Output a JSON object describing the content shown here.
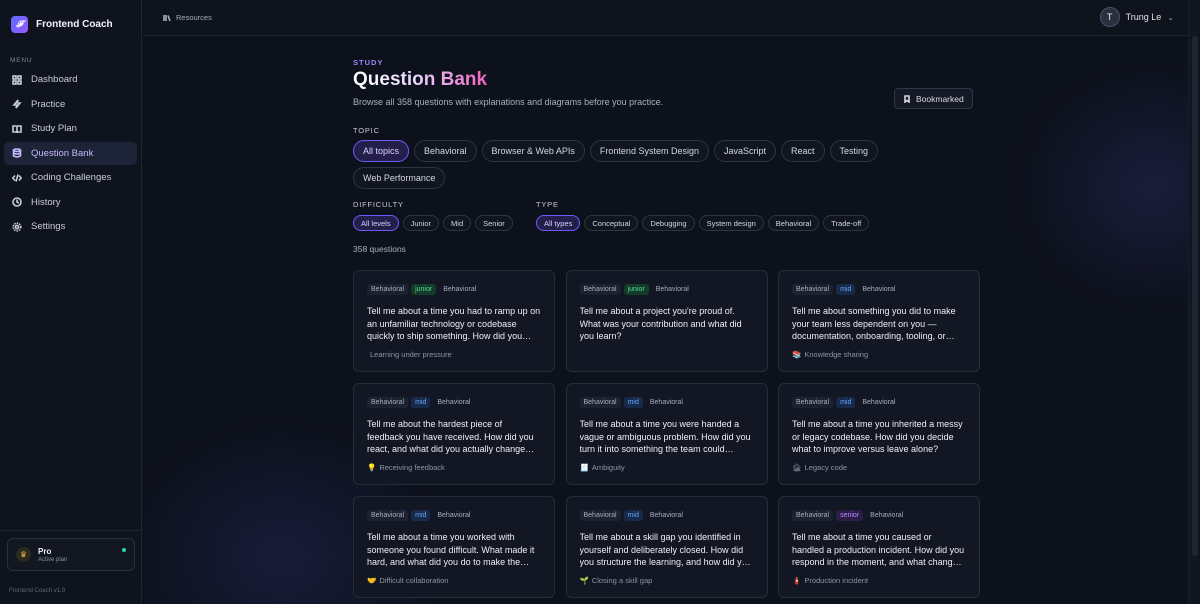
{
  "app": {
    "name": "Frontend Coach",
    "logo_glyph": "𝓕",
    "version": "Frontend Coach v1.0"
  },
  "sidebar": {
    "menu_label": "MENU",
    "items": [
      {
        "label": "Dashboard",
        "icon": "grid-icon"
      },
      {
        "label": "Practice",
        "icon": "bolt-icon"
      },
      {
        "label": "Study Plan",
        "icon": "book-icon"
      },
      {
        "label": "Question Bank",
        "icon": "database-icon",
        "active": true
      },
      {
        "label": "Coding Challenges",
        "icon": "code-icon"
      },
      {
        "label": "History",
        "icon": "clock-icon"
      },
      {
        "label": "Settings",
        "icon": "gear-icon"
      }
    ],
    "plan": {
      "title": "Pro",
      "subtitle": "Active plan",
      "icon": "crown-icon"
    }
  },
  "topbar": {
    "breadcrumb": "Resources",
    "user": {
      "initial": "T",
      "name": "Trung Le"
    }
  },
  "page": {
    "eyebrow": "STUDY",
    "title": "Question Bank",
    "subtitle": "Browse all 358 questions with explanations and diagrams before you practice.",
    "bookmarked_label": "Bookmarked",
    "topic_label": "TOPIC",
    "topics": [
      "All topics",
      "Behavioral",
      "Browser & Web APIs",
      "Frontend System Design",
      "JavaScript",
      "React",
      "Testing",
      "Web Performance"
    ],
    "difficulty_label": "DIFFICULTY",
    "difficulties": [
      "All levels",
      "Junior",
      "Mid",
      "Senior"
    ],
    "type_label": "TYPE",
    "types": [
      "All types",
      "Conceptual",
      "Debugging",
      "System design",
      "Behavioral",
      "Trade-off"
    ],
    "count": "358 questions"
  },
  "colors": {
    "accent": "#6b5bff",
    "junior": "#4ddc8f",
    "mid": "#6aa4ff",
    "senior": "#b98cff"
  },
  "cards": [
    {
      "topic": "Behavioral",
      "level": "junior",
      "type": "Behavioral",
      "question": "Tell me about a time you had to ramp up on an unfamiliar technology or codebase quickly to ship something. How did you approach it?",
      "tag_emoji": "",
      "tag": "Learning under pressure"
    },
    {
      "topic": "Behavioral",
      "level": "junior",
      "type": "Behavioral",
      "question": "Tell me about a project you're proud of. What was your contribution and what did you learn?",
      "tag_emoji": "",
      "tag": ""
    },
    {
      "topic": "Behavioral",
      "level": "mid",
      "type": "Behavioral",
      "question": "Tell me about something you did to make your team less dependent on you — documentation, onboarding, tooling, or mentoring.",
      "tag_emoji": "📚",
      "tag": "Knowledge sharing"
    },
    {
      "topic": "Behavioral",
      "level": "mid",
      "type": "Behavioral",
      "question": "Tell me about the hardest piece of feedback you have received. How did you react, and what did you actually change afterwards?",
      "tag_emoji": "💡",
      "tag": "Receiving feedback"
    },
    {
      "topic": "Behavioral",
      "level": "mid",
      "type": "Behavioral",
      "question": "Tell me about a time you were handed a vague or ambiguous problem. How did you turn it into something the team could execute on?",
      "tag_emoji": "🧾",
      "tag": "Ambiguity"
    },
    {
      "topic": "Behavioral",
      "level": "mid",
      "type": "Behavioral",
      "question": "Tell me about a time you inherited a messy or legacy codebase. How did you decide what to improve versus leave alone?",
      "tag_emoji": "🏚",
      "tag": "Legacy code"
    },
    {
      "topic": "Behavioral",
      "level": "mid",
      "type": "Behavioral",
      "question": "Tell me about a time you worked with someone you found difficult. What made it hard, and what did you do to make the relationship work?",
      "tag_emoji": "🤝",
      "tag": "Difficult collaboration"
    },
    {
      "topic": "Behavioral",
      "level": "mid",
      "type": "Behavioral",
      "question": "Tell me about a skill gap you identified in yourself and deliberately closed. How did you structure the learning, and how did you know it worked?",
      "tag_emoji": "🌱",
      "tag": "Closing a skill gap"
    },
    {
      "topic": "Behavioral",
      "level": "senior",
      "type": "Behavioral",
      "question": "Tell me about a time you caused or handled a production incident. How did you respond in the moment, and what changed afterwards?",
      "tag_emoji": "🧯",
      "tag": "Production incident"
    }
  ]
}
